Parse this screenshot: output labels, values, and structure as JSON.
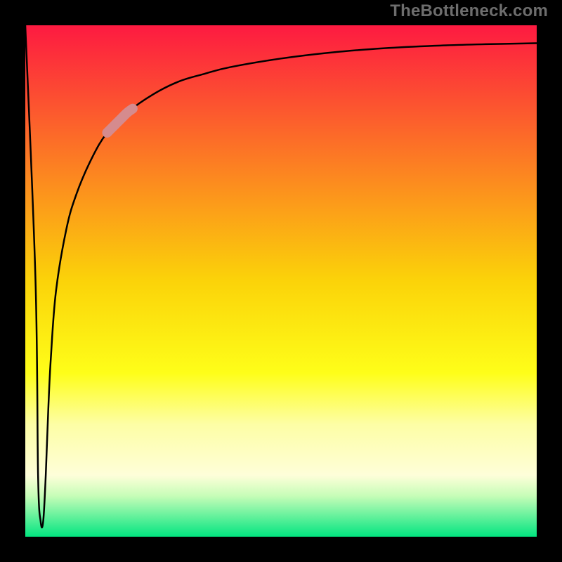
{
  "watermark": "TheBottleneck.com",
  "chart_data": {
    "type": "line",
    "title": "",
    "xlabel": "",
    "ylabel": "",
    "xlim": [
      0,
      1
    ],
    "ylim": [
      0,
      1
    ],
    "axes_visible": false,
    "frame_visible": true,
    "background_gradient": {
      "orientation": "vertical",
      "stops": [
        {
          "value": 0.0,
          "approx_bottleneck_pct": 100,
          "color": "#fd1a41"
        },
        {
          "value": 0.5,
          "approx_bottleneck_pct": 50,
          "color": "#fbd309"
        },
        {
          "value": 0.68,
          "approx_bottleneck_pct": 30,
          "color": "#fefe19"
        },
        {
          "value": 0.78,
          "approx_bottleneck_pct": 20,
          "color": "#fdfea5"
        },
        {
          "value": 0.88,
          "approx_bottleneck_pct": 10,
          "color": "#fefed9"
        },
        {
          "value": 0.92,
          "approx_bottleneck_pct": 5,
          "color": "#c7fdb8"
        },
        {
          "value": 1.0,
          "approx_bottleneck_pct": 0,
          "color": "#02e580"
        }
      ]
    },
    "series": [
      {
        "name": "curve",
        "x": [
          0.0,
          0.02,
          0.025,
          0.03,
          0.035,
          0.04,
          0.045,
          0.05,
          0.06,
          0.08,
          0.1,
          0.13,
          0.16,
          0.2,
          0.25,
          0.3,
          0.35,
          0.4,
          0.5,
          0.6,
          0.7,
          0.8,
          0.9,
          1.0
        ],
        "y": [
          1.0,
          0.5,
          0.12,
          0.03,
          0.03,
          0.12,
          0.25,
          0.35,
          0.48,
          0.6,
          0.67,
          0.74,
          0.79,
          0.83,
          0.865,
          0.89,
          0.905,
          0.918,
          0.935,
          0.947,
          0.955,
          0.96,
          0.963,
          0.965
        ]
      }
    ],
    "highlight_segment": {
      "series": "curve",
      "x_range": [
        0.16,
        0.21
      ],
      "color": "#d58b8e",
      "approx_y_range": [
        0.79,
        0.835
      ]
    }
  }
}
